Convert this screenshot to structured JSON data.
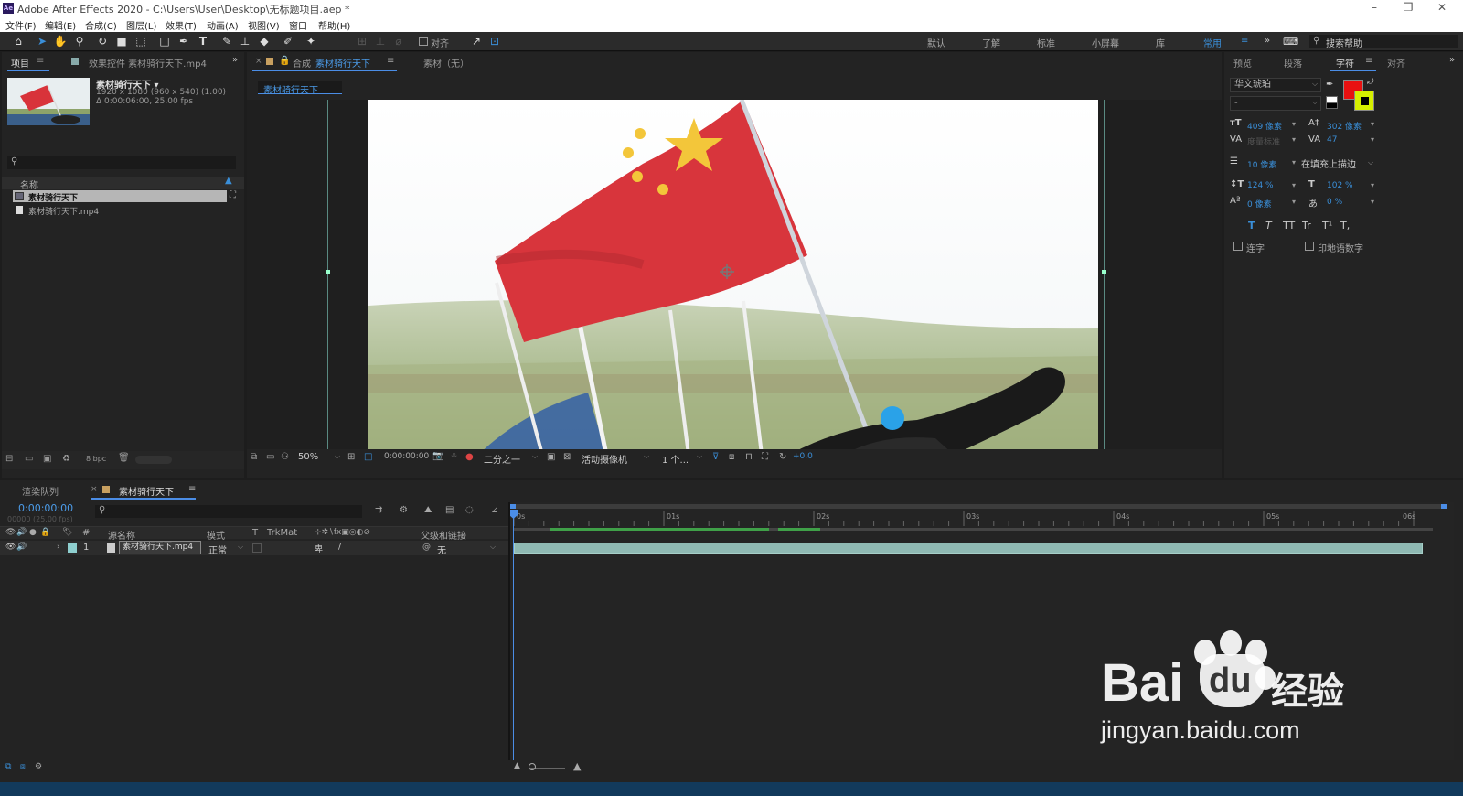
{
  "window": {
    "app_badge": "Ae",
    "title": "Adobe After Effects 2020 - C:\\Users\\User\\Desktop\\无标题项目.aep *",
    "min": "–",
    "max": "❐",
    "close": "✕"
  },
  "menu": [
    "文件(F)",
    "编辑(E)",
    "合成(C)",
    "图层(L)",
    "效果(T)",
    "动画(A)",
    "视图(V)",
    "窗口",
    "帮助(H)"
  ],
  "toolbar": {
    "snap_label": "对齐",
    "workspaces": [
      "默认",
      "了解",
      "标准",
      "小屏幕",
      "库"
    ],
    "active_workspace": "常用",
    "more": "»",
    "search_placeholder": "搜索帮助"
  },
  "project_panel": {
    "tab_project": "项目",
    "tab_effects": "效果控件 素材骑行天下.mp4",
    "expand": "»",
    "preview_name": "素材骑行天下 ▾",
    "preview_info1": "1920 x 1080  (960 x 540) (1.00)",
    "preview_info2": "Δ 0:00:06:00, 25.00 fps",
    "col_name": "名称",
    "items": [
      {
        "name": "素材骑行天下",
        "type": "comp"
      },
      {
        "name": "素材骑行天下.mp4",
        "type": "footage"
      }
    ],
    "bpc": "8 bpc"
  },
  "comp_panel": {
    "tab_prefix": "合成",
    "tab_name": "素材骑行天下",
    "footage_tab": "素材（无）",
    "breadcrumb": "素材骑行天下",
    "zoom": "50%",
    "timecode": "0:00:00:00",
    "resolution": "二分之一",
    "camera": "活动摄像机",
    "views": "1 个...",
    "exposure": "+0.0"
  },
  "character_panel": {
    "tabs": [
      "预览",
      "段落",
      "字符",
      "对齐"
    ],
    "active_tab": "字符",
    "font": "华文琥珀",
    "style": "-",
    "size": "409 像素",
    "leading": "302 像素",
    "kerning": "度量标准",
    "tracking": "47",
    "stroke_width": "10 像素",
    "stroke_mode": "在填充上描边",
    "vscale": "124 %",
    "hscale": "102 %",
    "baseline": "0 像素",
    "tsume": "0 %",
    "style_buttons": [
      "T",
      "T",
      "TT",
      "Tr",
      "T¹",
      "T,"
    ],
    "ligatures": "连字",
    "hindi_digits": "印地语数字",
    "fill_color": "#e81010",
    "stroke_color": "#d6f000"
  },
  "timeline": {
    "tab_render": "渲染队列",
    "tab_comp": "素材骑行天下",
    "timecode": "0:00:00:00",
    "fps": "00000 (25.00 fps)",
    "headers": {
      "num": "#",
      "source": "源名称",
      "mode": "模式",
      "t": "T",
      "trkmat": "TrkMat",
      "parent": "父级和链接"
    },
    "layer": {
      "num": "1",
      "name": "素材骑行天下.mp4",
      "mode": "正常",
      "parent": "无"
    },
    "ruler": [
      "0s",
      "01s",
      "02s",
      "03s",
      "04s",
      "05s",
      "06s"
    ],
    "ruler_max": 6
  },
  "watermark": {
    "brand": "Bai",
    "brand2": "经验",
    "url": "jingyan.baidu.com"
  }
}
